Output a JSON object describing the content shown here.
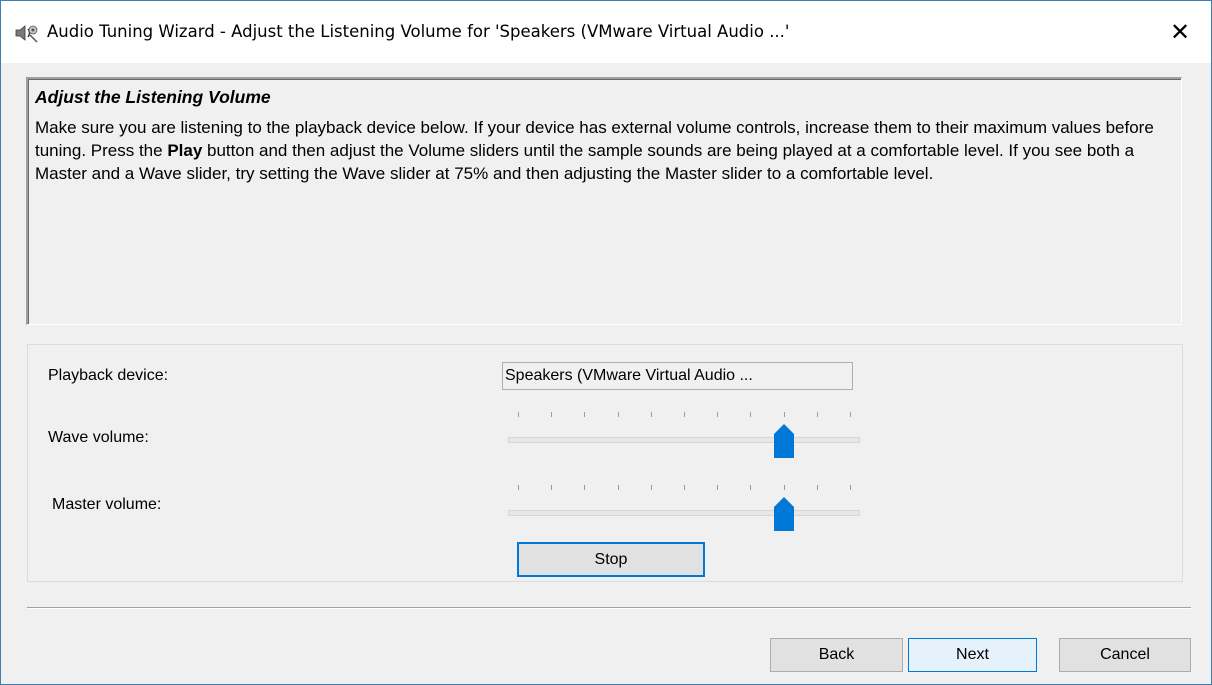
{
  "window": {
    "title": "Audio Tuning Wizard - Adjust the Listening Volume for 'Speakers (VMware Virtual Audio ...'",
    "close_glyph": "✕",
    "app_icon": "speaker-icon"
  },
  "info": {
    "heading": "Adjust the Listening Volume",
    "body_part1": "Make sure you are listening to the playback device below. If your device has external volume controls, increase them to their maximum values before tuning. Press the ",
    "body_bold": "Play",
    "body_part2": " button and then adjust the Volume sliders until the sample sounds are being played at a comfortable level. If you see both a Master and a Wave slider, try setting the Wave slider at 75% and then adjusting the Master slider to a comfortable level."
  },
  "form": {
    "playback_label": "Playback device:",
    "playback_value": "Speakers (VMware Virtual Audio ...",
    "wave_label": "Wave volume:",
    "wave_level": 0.8,
    "master_label": "Master volume:",
    "master_level": 0.8,
    "tick_count": 11,
    "stop_label": "Stop"
  },
  "footer": {
    "back_label": "Back",
    "next_label": "Next",
    "cancel_label": "Cancel"
  },
  "colors": {
    "accent": "#0078d7",
    "window_border": "#3c7fb1",
    "face": "#f0f0f0"
  }
}
